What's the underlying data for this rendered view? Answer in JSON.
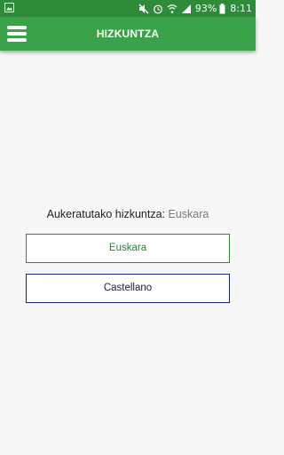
{
  "status_bar": {
    "battery_text": "93%",
    "time": "8:11",
    "icons": [
      "image-notification-icon",
      "mute-icon",
      "alarm-icon",
      "wifi-icon",
      "signal-icon",
      "battery-icon"
    ]
  },
  "app_bar": {
    "title": "HIZKUNTZA",
    "menu_icon": "hamburger-menu-icon"
  },
  "selection": {
    "label": "Aukeratutako hizkuntza:",
    "value": "Euskara"
  },
  "languages": {
    "euskara": "Euskara",
    "castellano": "Castellano"
  },
  "colors": {
    "status_bar": "#2e8b3a",
    "app_bar": "#3aa34a",
    "euskara_border": "#2e8b3a",
    "castellano_border": "#1a237e"
  }
}
